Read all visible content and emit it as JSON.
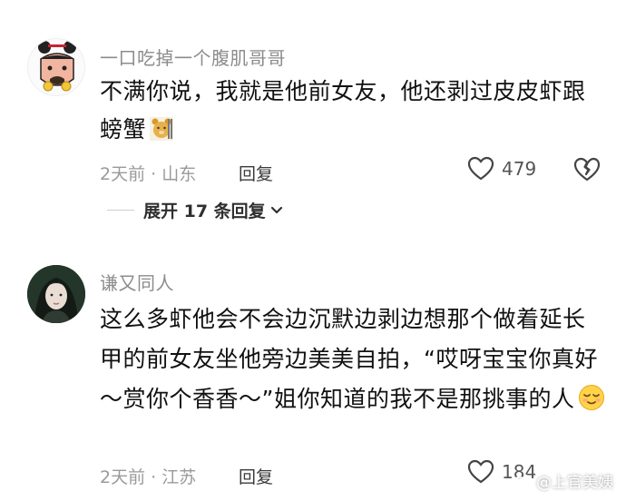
{
  "comments": [
    {
      "username": "一口吃掉一个腹肌哥哥",
      "text": "不满你说，我就是他前女友，他还剥过皮皮虾跟螃蟹",
      "emoji": "bear-emoji",
      "time_location": "2天前 · 山东",
      "reply_label": "回复",
      "likes": "479",
      "expand_label": "展开 17 条回复"
    },
    {
      "username": "谦又同人",
      "text": "这么多虾他会不会边沉默边剥边想那个做着延长甲的前女友坐他旁边美美自拍，“哎呀宝宝你真好～赏你个香香～”姐你知道的我不是那挑事的人",
      "emoji": "content-face-emoji",
      "time_location": "2天前 · 江苏",
      "reply_label": "回复",
      "likes": "184"
    }
  ],
  "watermark": "@上官美姨",
  "colors": {
    "meta_gray": "#9a9a9a",
    "username_gray": "#8c8c8c",
    "text": "#111111"
  }
}
